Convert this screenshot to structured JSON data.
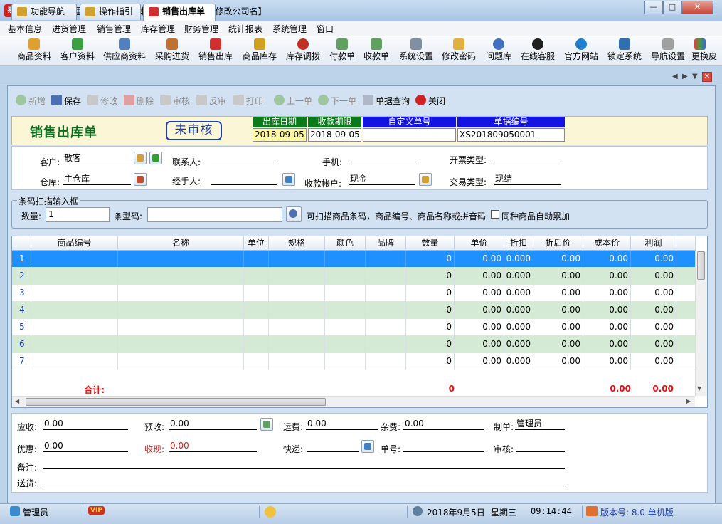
{
  "window": {
    "title": "易特进销存管理软件--【请在基本信息，公司信息中修改公司名】",
    "icon_text": "易"
  },
  "menu": [
    "基本信息",
    "进货管理",
    "销售管理",
    "库存管理",
    "财务管理",
    "统计报表",
    "系统管理",
    "窗口"
  ],
  "toolbar": [
    "商品资料",
    "客户资料",
    "供应商资料",
    "采购进货",
    "销售出库",
    "商品库存",
    "库存调拨",
    "付款单",
    "收款单",
    "系统设置",
    "修改密码",
    "问题库",
    "在线客服",
    "官方网站",
    "锁定系统",
    "导航设置",
    "更换皮"
  ],
  "tabs": [
    "功能导航",
    "操作指引",
    "销售出库单"
  ],
  "actions": [
    {
      "label": "新增",
      "enabled": false
    },
    {
      "label": "保存",
      "enabled": true
    },
    {
      "label": "修改",
      "enabled": false
    },
    {
      "label": "删除",
      "enabled": false
    },
    {
      "label": "审核",
      "enabled": false
    },
    {
      "label": "反审",
      "enabled": false
    },
    {
      "label": "打印",
      "enabled": false
    },
    {
      "label": "上一单",
      "enabled": false
    },
    {
      "label": "下一单",
      "enabled": false
    },
    {
      "label": "单据查询",
      "enabled": true
    },
    {
      "label": "关闭",
      "enabled": true
    }
  ],
  "header": {
    "form_title": "销售出库单",
    "stamp": "未审核",
    "fields": [
      {
        "label": "出库日期",
        "value": "2018-09-05"
      },
      {
        "label": "收款期限",
        "value": "2018-09-05"
      },
      {
        "label": "自定义单号",
        "value": ""
      },
      {
        "label": "单据编号",
        "value": "XS201809050001"
      }
    ]
  },
  "info": {
    "customer_label": "客户:",
    "customer": "散客",
    "contact_label": "联系人:",
    "contact": "",
    "phone_label": "手机:",
    "phone": "",
    "invoice_label": "开票类型:",
    "invoice": "",
    "warehouse_label": "仓库:",
    "warehouse": "主仓库",
    "handler_label": "经手人:",
    "handler": "",
    "account_label": "收款帐户:",
    "account": "现金",
    "trade_label": "交易类型:",
    "trade": "现结"
  },
  "scan": {
    "legend": "条码扫描输入框",
    "qty_label": "数量:",
    "qty": "1",
    "code_label": "条型码:",
    "code": "",
    "hint": "可扫描商品条码，商品编号、商品名称或拼音码",
    "auto_label": "同种商品自动累加"
  },
  "grid": {
    "columns": [
      "商品编号",
      "名称",
      "单位",
      "规格",
      "颜色",
      "品牌",
      "数量",
      "单价",
      "折扣",
      "折后价",
      "成本价",
      "利润"
    ],
    "rows": [
      {
        "n": "1",
        "qty": "0",
        "price": "0.00",
        "disc": "0.000",
        "after": "0.00",
        "cost": "0.00",
        "profit": "0.00"
      },
      {
        "n": "2",
        "qty": "0",
        "price": "0.00",
        "disc": "0.000",
        "after": "0.00",
        "cost": "0.00",
        "profit": "0.00"
      },
      {
        "n": "3",
        "qty": "0",
        "price": "0.00",
        "disc": "0.000",
        "after": "0.00",
        "cost": "0.00",
        "profit": "0.00"
      },
      {
        "n": "4",
        "qty": "0",
        "price": "0.00",
        "disc": "0.000",
        "after": "0.00",
        "cost": "0.00",
        "profit": "0.00"
      },
      {
        "n": "5",
        "qty": "0",
        "price": "0.00",
        "disc": "0.000",
        "after": "0.00",
        "cost": "0.00",
        "profit": "0.00"
      },
      {
        "n": "6",
        "qty": "0",
        "price": "0.00",
        "disc": "0.000",
        "after": "0.00",
        "cost": "0.00",
        "profit": "0.00"
      },
      {
        "n": "7",
        "qty": "0",
        "price": "0.00",
        "disc": "0.000",
        "after": "0.00",
        "cost": "0.00",
        "profit": "0.00"
      }
    ],
    "total_label": "合计:",
    "total_qty": "0",
    "total_cost": "0.00",
    "total_profit": "0.00"
  },
  "footer": {
    "receivable_label": "应收:",
    "receivable": "0.00",
    "prepaid_label": "预收:",
    "prepaid": "0.00",
    "freight_label": "运费:",
    "freight": "0.00",
    "misc_label": "杂费:",
    "misc": "0.00",
    "maker_label": "制单:",
    "maker": "管理员",
    "discount_label": "优惠:",
    "discount": "0.00",
    "cash_label": "收现:",
    "cash": "0.00",
    "express_label": "快递:",
    "express": "",
    "no_label": "单号:",
    "no": "",
    "auditor_label": "审核:",
    "auditor": "",
    "remark_label": "备注:",
    "remark": "",
    "delivery_label": "送货:",
    "delivery": ""
  },
  "status": {
    "user": "管理员",
    "vip": "VIP",
    "date": "2018年9月5日",
    "weekday": "星期三",
    "time": "09:14:44",
    "version": "版本号: 8.0 单机版"
  },
  "colors": {
    "accent_green": "#0a6e1e",
    "header_green": "#0a7a1a",
    "header_blue": "#1414e0",
    "selected_row": "#1e90ff",
    "alt_row": "#d4ead4",
    "total_red": "#e01010"
  }
}
